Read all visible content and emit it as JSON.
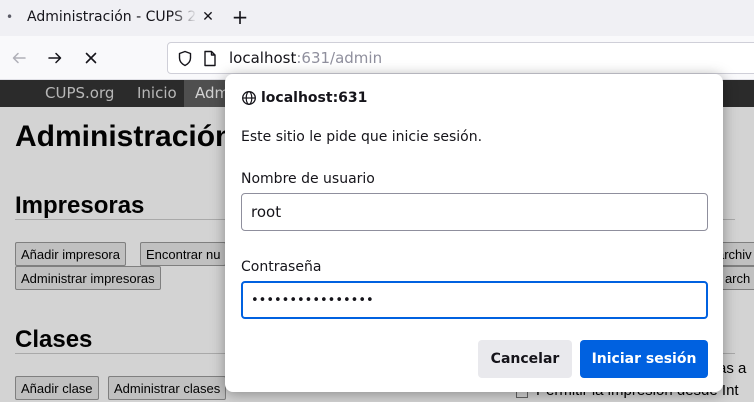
{
  "browser": {
    "tab": {
      "title": "Administración - CUPS 2.",
      "close_glyph": "✕"
    },
    "new_tab_glyph": "+",
    "url": {
      "host": "localhost",
      "path": ":631/admin"
    }
  },
  "cups": {
    "nav": [
      "CUPS.org",
      "Inicio",
      "Adm"
    ],
    "page_title": "Administración",
    "sections": {
      "printers": {
        "heading": "Impresoras",
        "buttons": [
          "Añadir impresora",
          "Encontrar nu",
          "Administrar impresoras"
        ]
      },
      "classes": {
        "heading": "Clases",
        "buttons": [
          "Añadir clase",
          "Administrar clases"
        ]
      }
    },
    "side_fragments": [
      "archiv",
      "r arch",
      "as a",
      "Permitir la impresión desde Int"
    ]
  },
  "dialog": {
    "host": "localhost:631",
    "message": "Este sitio le pide que inicie sesión.",
    "username_label": "Nombre de usuario",
    "username_value": "root",
    "password_label": "Contraseña",
    "password_value": "••••••••••••••••",
    "cancel_label": "Cancelar",
    "login_label": "Iniciar sesión"
  },
  "colors": {
    "accent": "#0061e0",
    "cups_nav": "#333333"
  }
}
